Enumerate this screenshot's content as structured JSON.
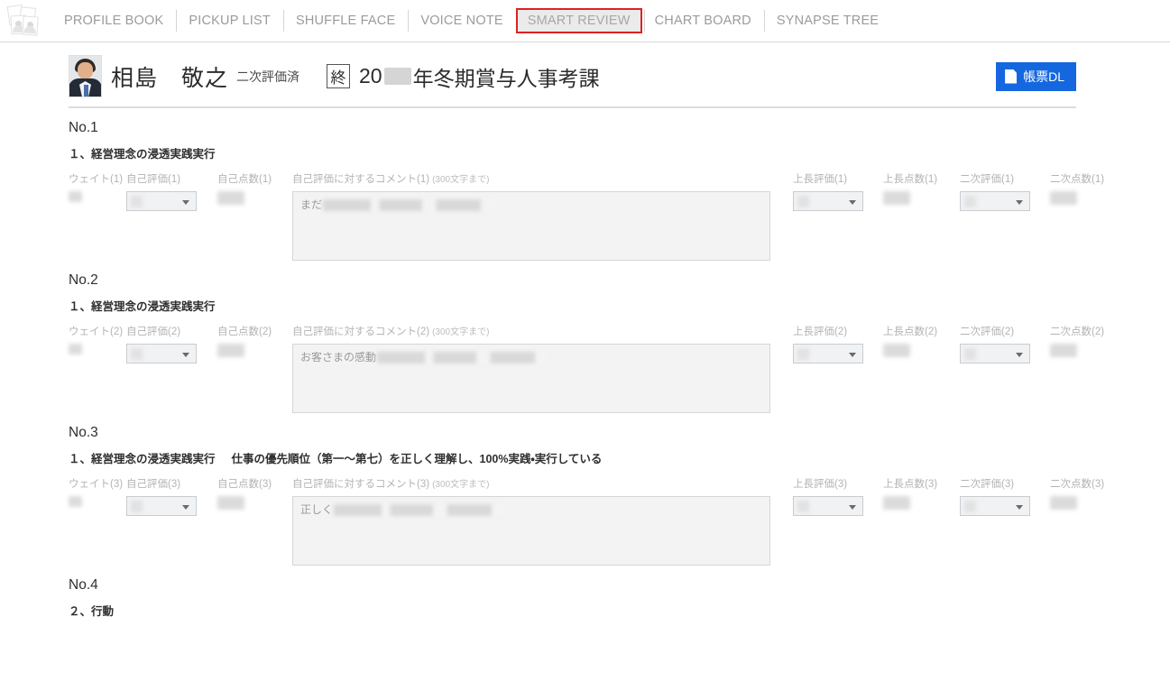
{
  "nav": {
    "logo_icon": "profile-cards-icon",
    "items": [
      {
        "label": "PROFILE BOOK",
        "active": false
      },
      {
        "label": "PICKUP LIST",
        "active": false
      },
      {
        "label": "SHUFFLE FACE",
        "active": false
      },
      {
        "label": "VOICE NOTE",
        "active": false
      },
      {
        "label": "SMART REVIEW",
        "active": true
      },
      {
        "label": "CHART BOARD",
        "active": false
      },
      {
        "label": "SYNAPSE TREE",
        "active": false
      }
    ],
    "active_highlight_color": "#dd2222"
  },
  "header": {
    "avatar_icon": "employee-photo",
    "name": "相島　敬之",
    "status": "二次評価済",
    "term_badge": "終",
    "title_prefix": "20",
    "title_suffix": "年冬期賞与人事考課",
    "download_button": {
      "label": "帳票DL",
      "icon": "document-icon",
      "color": "#1567e0"
    }
  },
  "labels": {
    "weight": "ウェイト",
    "self_rating": "自己評価",
    "self_score": "自己点数",
    "self_comment": "自己評価に対するコメント",
    "comment_limit": "(300文字まで)",
    "supervisor_rating": "上長評価",
    "supervisor_score": "上長点数",
    "secondary_rating": "二次評価",
    "secondary_score": "二次点数"
  },
  "items": [
    {
      "no": "No.1",
      "index": "(1)",
      "category": "１、経営理念の浸透実践実行",
      "description": "",
      "description_redacted": true,
      "comment_text": "まだ",
      "comment_redacted": true
    },
    {
      "no": "No.2",
      "index": "(2)",
      "category": "１、経営理念の浸透実践実行",
      "description": "",
      "description_redacted": true,
      "comment_text": "お客さまの感動",
      "comment_redacted": true
    },
    {
      "no": "No.3",
      "index": "(3)",
      "category": "１、経営理念の浸透実践実行",
      "description": "仕事の優先順位（第一～第七）を正しく理解し、100%実践・実行している",
      "description_redacted": false,
      "comment_text": "正しく",
      "comment_redacted": true
    },
    {
      "no": "No.4",
      "index": "(4)",
      "category": "２、行動",
      "description": "",
      "description_redacted": true,
      "comment_text": "",
      "comment_redacted": true
    }
  ]
}
